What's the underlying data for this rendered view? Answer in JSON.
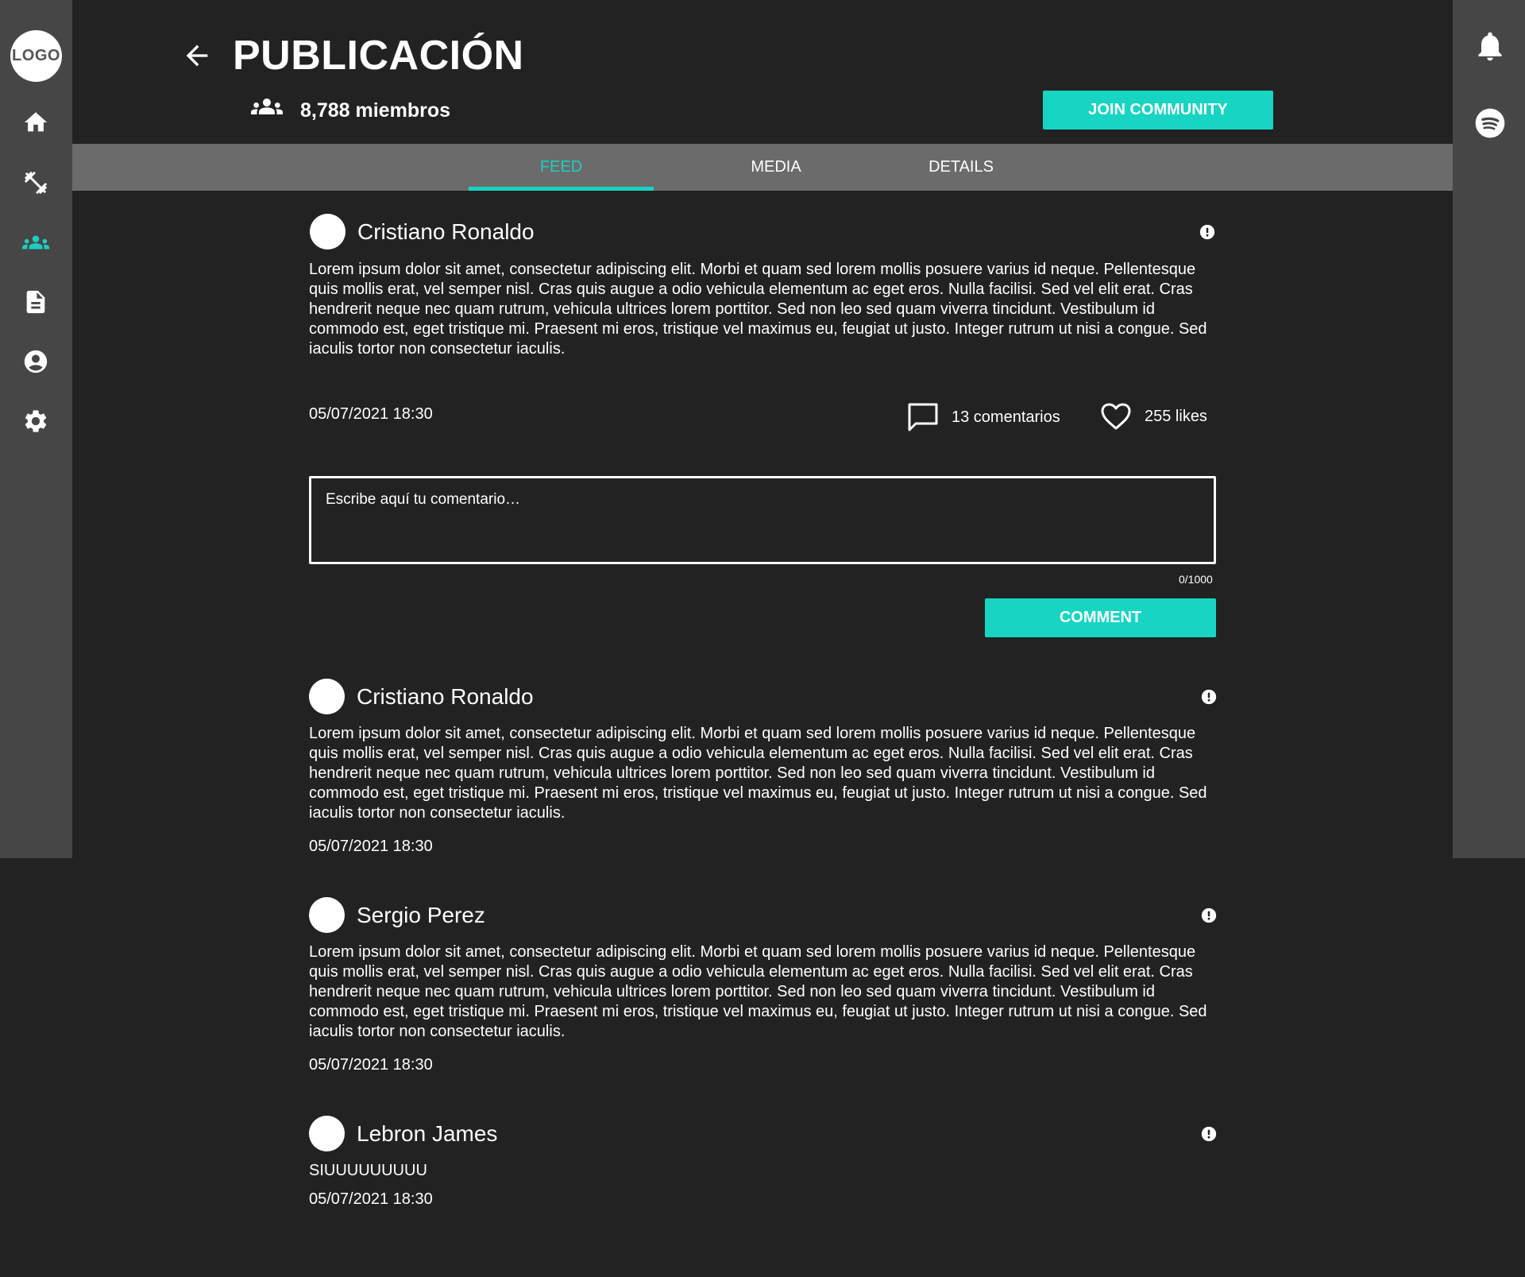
{
  "logo": "LOGO",
  "nav": {
    "items": [
      {
        "icon": "home-icon"
      },
      {
        "icon": "fitness-icon"
      },
      {
        "icon": "community-icon",
        "active": true
      },
      {
        "icon": "article-icon"
      },
      {
        "icon": "account-icon"
      },
      {
        "icon": "settings-icon"
      }
    ]
  },
  "right_bar": {
    "icons": [
      "bell-icon",
      "spotify-icon"
    ]
  },
  "header": {
    "title": "PUBLICACIÓN",
    "members": "8,788 miembros",
    "join_label": "JOIN COMMUNITY"
  },
  "tabs": [
    {
      "label": "FEED",
      "active": true
    },
    {
      "label": "MEDIA"
    },
    {
      "label": "DETAILS"
    }
  ],
  "main_post": {
    "author": "Cristiano Ronaldo",
    "body": "Lorem ipsum dolor sit amet, consectetur adipiscing elit. Morbi et quam sed lorem mollis posuere varius id neque. Pellentesque quis mollis erat, vel semper nisl. Cras quis augue a odio vehicula elementum ac eget eros. Nulla facilisi. Sed vel elit erat. Cras hendrerit neque nec quam rutrum, vehicula ultrices lorem porttitor. Sed non leo sed quam viverra tincidunt. Vestibulum id commodo est, eget tristique mi. Praesent mi eros, tristique vel maximus eu, feugiat ut justo. Integer rutrum ut nisi a congue. Sed iaculis tortor non consectetur iaculis.",
    "date": "05/07/2021 18:30",
    "comments": "13 comentarios",
    "likes": "255 likes"
  },
  "comment_form": {
    "placeholder": "Escribe aquí tu comentario…",
    "count": "0/1000",
    "submit_label": "COMMENT"
  },
  "comments": [
    {
      "author": "Cristiano Ronaldo",
      "body": "Lorem ipsum dolor sit amet, consectetur adipiscing elit. Morbi et quam sed lorem mollis posuere varius id neque. Pellentesque quis mollis erat, vel semper nisl. Cras quis augue a odio vehicula elementum ac eget eros. Nulla facilisi. Sed vel elit erat. Cras hendrerit neque nec quam rutrum, vehicula ultrices lorem porttitor. Sed non leo sed quam viverra tincidunt. Vestibulum id commodo est, eget tristique mi. Praesent mi eros, tristique vel maximus eu, feugiat ut justo. Integer rutrum ut nisi a congue. Sed iaculis tortor non consectetur iaculis.",
      "date": "05/07/2021 18:30"
    },
    {
      "author": "Sergio Perez",
      "body": "Lorem ipsum dolor sit amet, consectetur adipiscing elit. Morbi et quam sed lorem mollis posuere varius id neque. Pellentesque quis mollis erat, vel semper nisl. Cras quis augue a odio vehicula elementum ac eget eros. Nulla facilisi. Sed vel elit erat. Cras hendrerit neque nec quam rutrum, vehicula ultrices lorem porttitor. Sed non leo sed quam viverra tincidunt. Vestibulum id commodo est, eget tristique mi. Praesent mi eros, tristique vel maximus eu, feugiat ut justo. Integer rutrum ut nisi a congue. Sed iaculis tortor non consectetur iaculis.",
      "date": "05/07/2021 18:30"
    },
    {
      "author": "Lebron James",
      "body": "SIUUUUUUUUU",
      "date": "05/07/2021 18:30"
    }
  ],
  "colors": {
    "accent": "#17d4c3",
    "background": "#222222",
    "sidebar": "#464646",
    "tabs_bar": "#6b6b6b"
  }
}
